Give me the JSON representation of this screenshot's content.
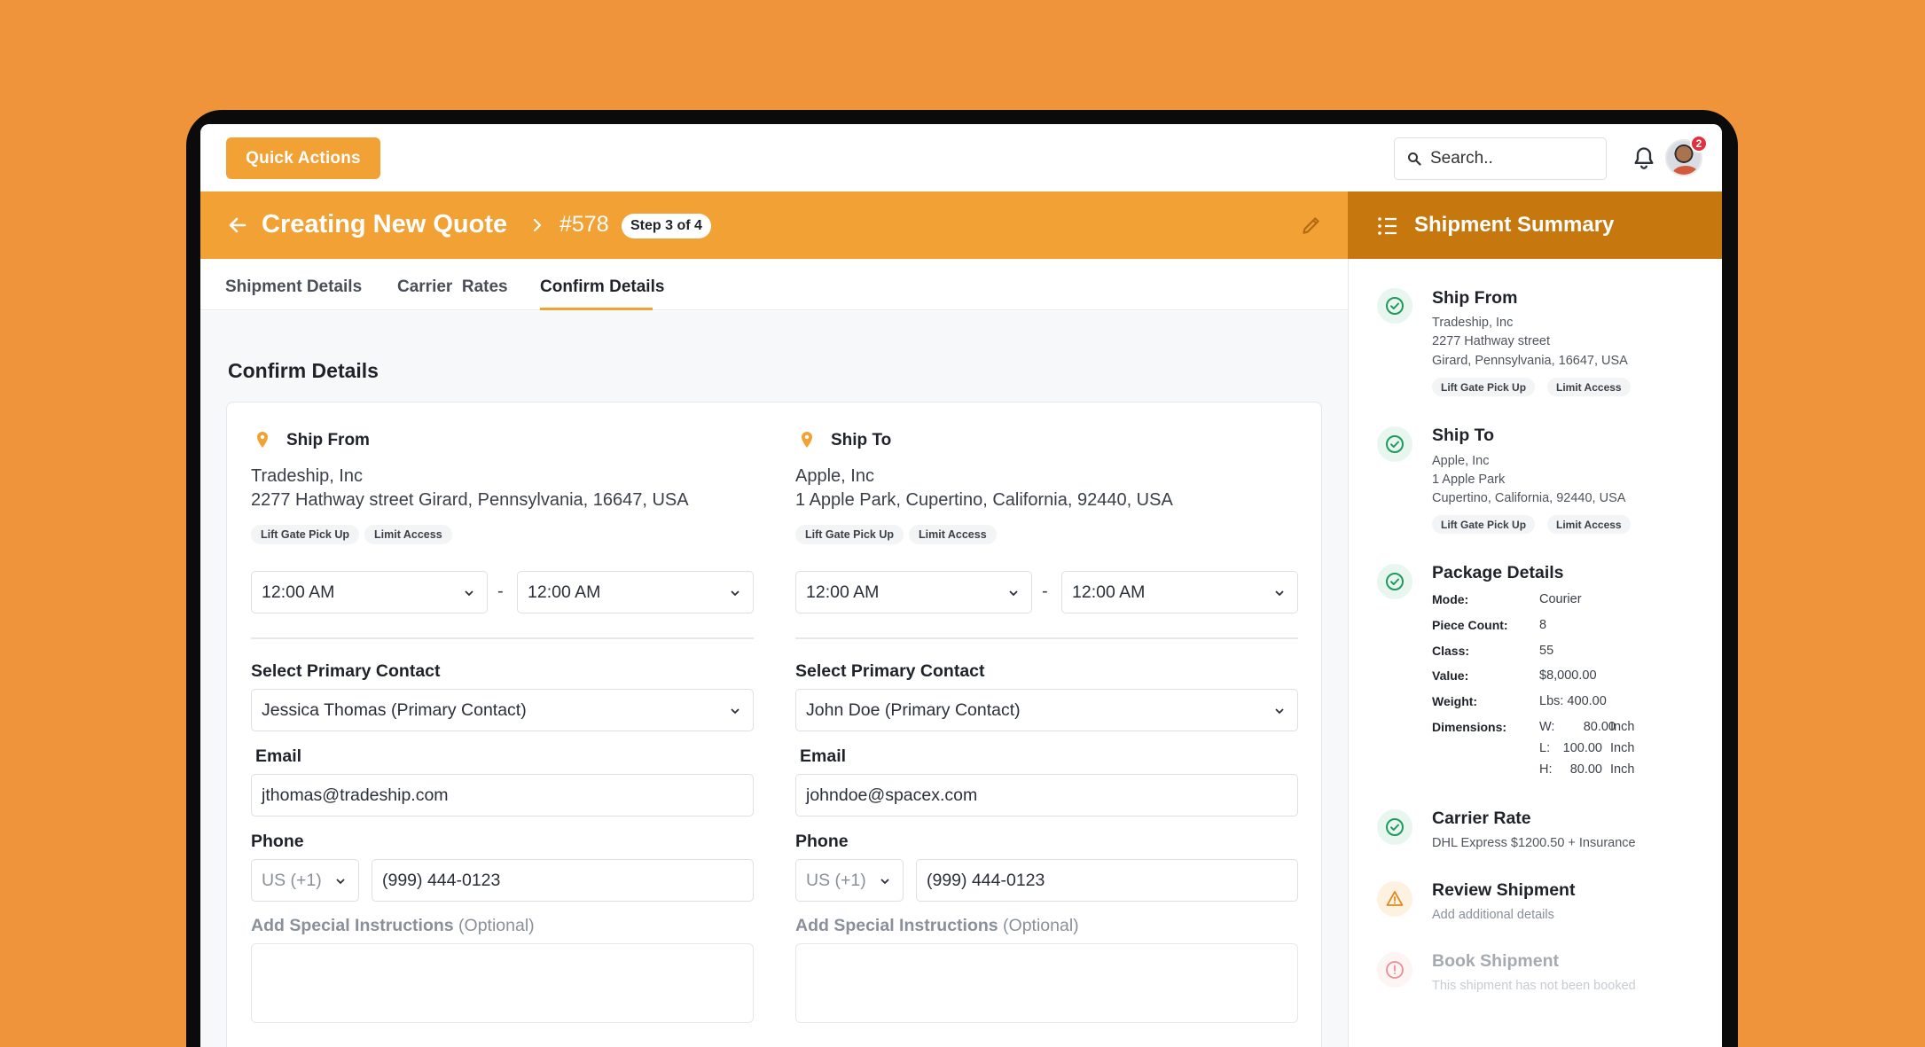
{
  "topbar": {
    "quick_actions": "Quick Actions",
    "search_placeholder": "Search..",
    "notification_count": "2"
  },
  "header": {
    "title": "Creating New Quote",
    "quote_id": "#578",
    "step": "Step 3 of 4",
    "summary_title": "Shipment Summary"
  },
  "tabs": [
    {
      "label": "Shipment Details",
      "active": false
    },
    {
      "label": "Carrier  Rates",
      "active": false
    },
    {
      "label": "Confirm Details",
      "active": true
    }
  ],
  "main": {
    "section_title": "Confirm Details",
    "ship_from": {
      "title": "Ship From",
      "company": "Tradeship, Inc",
      "address": "2277 Hathway street Girard, Pennsylvania, 16647, USA",
      "tags": [
        "Lift Gate Pick Up",
        "Limit Access"
      ],
      "time_start": "12:00 AM",
      "time_end": "12:00 AM",
      "time_sep": "-",
      "contact_label": "Select Primary Contact",
      "contact": "Jessica Thomas (Primary Contact)",
      "email_label": "Email",
      "email": "jthomas@tradeship.com",
      "phone_label": "Phone",
      "phone_code": "US (+1)",
      "phone": "(999) 444-0123",
      "instructions_label": "Add Special Instructions",
      "instructions_optional": "(Optional)"
    },
    "ship_to": {
      "title": "Ship To",
      "company": "Apple, Inc",
      "address": "1 Apple Park, Cupertino, California, 92440, USA",
      "tags": [
        "Lift Gate Pick Up",
        "Limit Access"
      ],
      "time_start": "12:00 AM",
      "time_end": "12:00 AM",
      "time_sep": "-",
      "contact_label": "Select Primary Contact",
      "contact": "John Doe (Primary Contact)",
      "email_label": "Email",
      "email": "johndoe@spacex.com",
      "phone_label": "Phone",
      "phone_code": "US (+1)",
      "phone": "(999) 444-0123",
      "instructions_label": "Add Special Instructions",
      "instructions_optional": "(Optional)"
    }
  },
  "summary": {
    "ship_from": {
      "title": "Ship From",
      "lines": [
        "Tradeship, Inc",
        "2277 Hathway street",
        "Girard, Pennsylvania, 16647, USA"
      ],
      "tags": [
        "Lift Gate Pick Up",
        "Limit Access"
      ]
    },
    "ship_to": {
      "title": "Ship To",
      "lines": [
        "Apple, Inc",
        "1 Apple Park",
        "Cupertino, California, 92440, USA"
      ],
      "tags": [
        "Lift Gate Pick Up",
        "Limit Access"
      ]
    },
    "package": {
      "title": "Package Details",
      "rows": [
        {
          "k": "Mode:",
          "v": "Courier"
        },
        {
          "k": "Piece Count:",
          "v": "8"
        },
        {
          "k": "Class:",
          "v": "55"
        },
        {
          "k": "Value:",
          "v": "$8,000.00"
        },
        {
          "k": "Weight:",
          "v": "Lbs: 400.00"
        }
      ],
      "dimensions_label": "Dimensions:",
      "dimensions": [
        {
          "axis": "W:",
          "value": "80.00",
          "unit": "Inch"
        },
        {
          "axis": "L:",
          "value": "100.00",
          "unit": "Inch"
        },
        {
          "axis": "H:",
          "value": "80.00",
          "unit": "Inch"
        }
      ]
    },
    "carrier": {
      "title": "Carrier Rate",
      "text": "DHL Express $1200.50 + Insurance"
    },
    "review": {
      "title": "Review Shipment",
      "text": "Add additional details"
    },
    "book": {
      "title": "Book Shipment",
      "text": "This shipment has not been booked"
    }
  },
  "colors": {
    "background": "#F0943B",
    "accent": "#F2A135",
    "summary_header": "#C6780E",
    "success": "#1f9a5c",
    "warning": "#e08a1e",
    "error": "#e0313c"
  }
}
